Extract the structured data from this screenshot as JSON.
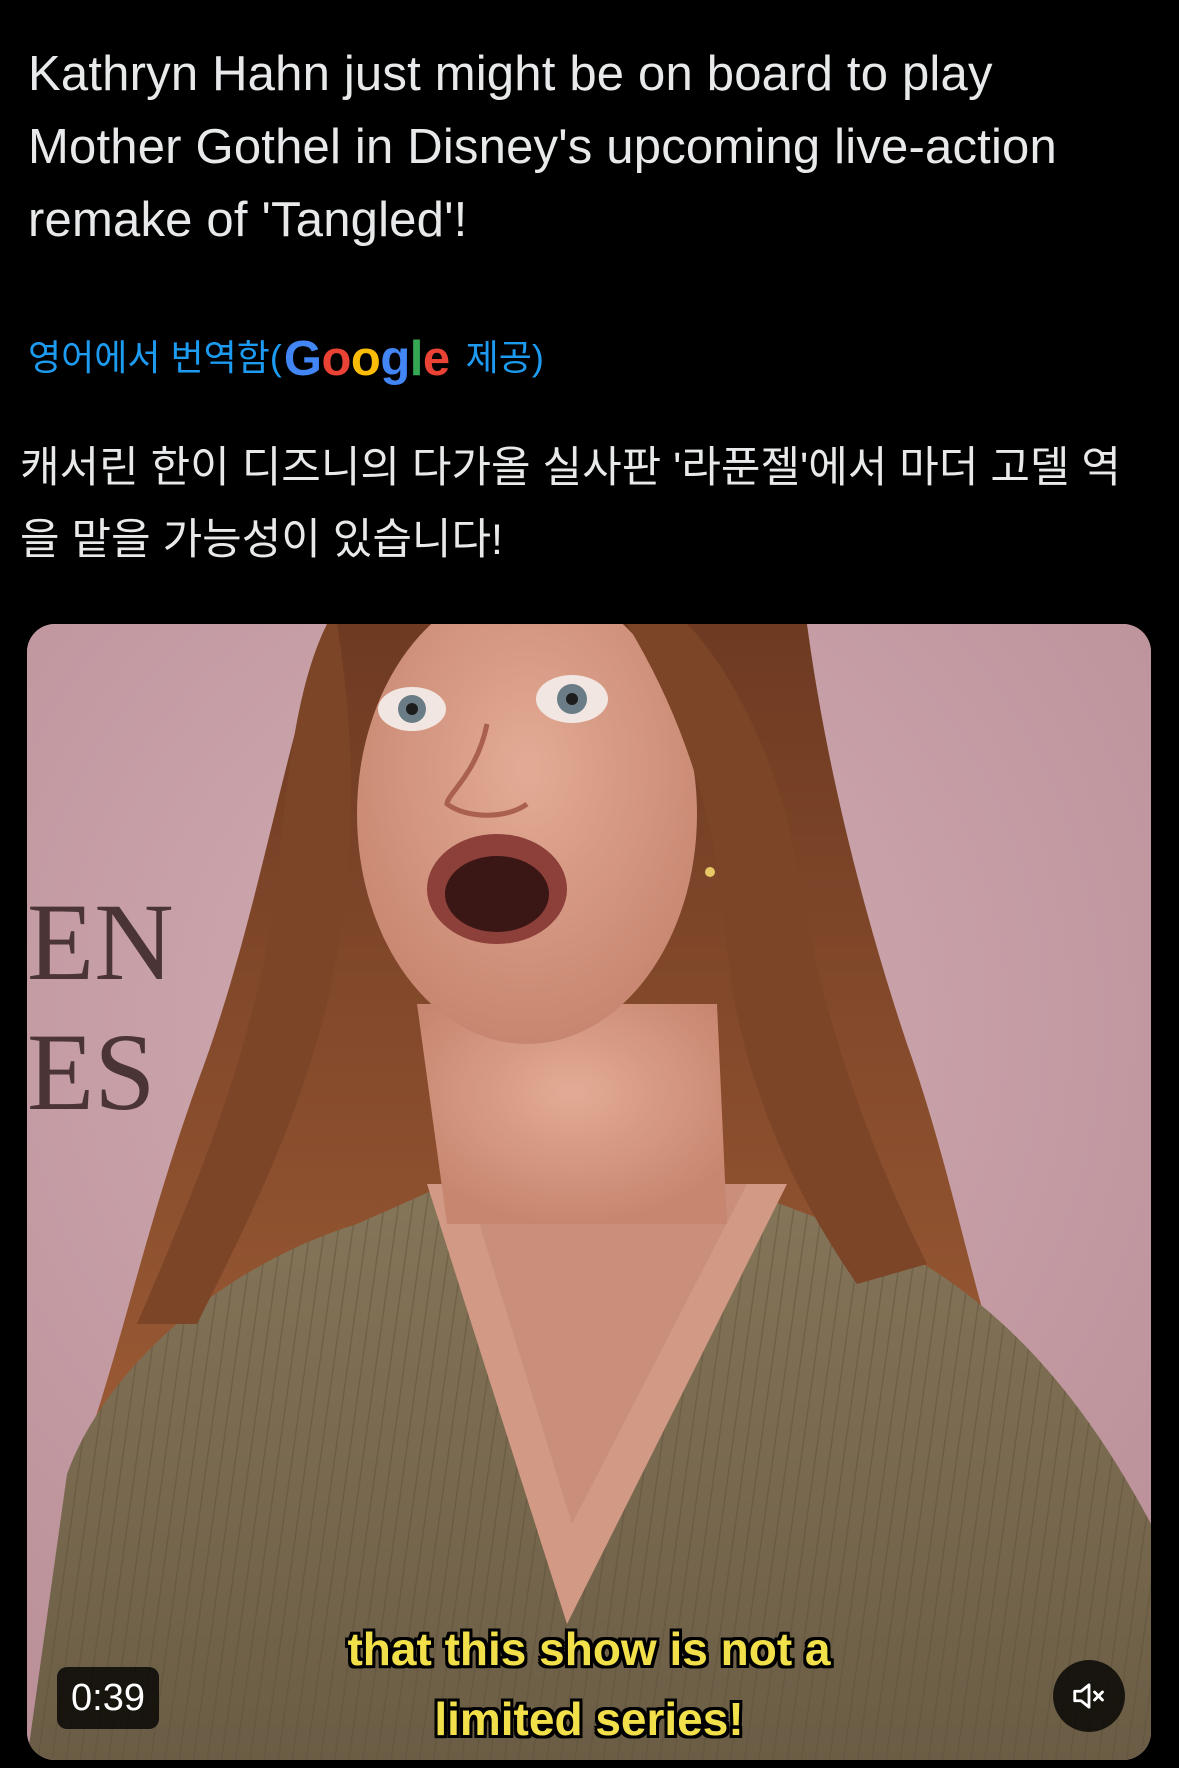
{
  "tweet": {
    "text": "Kathryn Hahn just might be on board to play Mother Gothel in Disney's upcoming live-action remake of 'Tangled'!"
  },
  "translation": {
    "translated_from": "영어에서 번역함(",
    "provider": "Google",
    "provided_by": "제공)",
    "text": "캐서린 한이 디즈니의 다가올 실사판 '라푼젤'에서 마더 고델 역을 맡을 가능성이 있습니다!"
  },
  "video": {
    "caption_line1": "that this show is not a",
    "caption_line2": "limited series!",
    "time_remaining": "0:39",
    "backdrop_letters_1": "EN",
    "backdrop_letters_2": "ES",
    "mute_icon": "speaker-muted-icon"
  },
  "colors": {
    "background": "#000000",
    "text": "#e7e9ea",
    "link": "#1d9bf0",
    "caption": "#f2e04a",
    "google_blue": "#4285f4",
    "google_red": "#ea4335",
    "google_yellow": "#fbbc05",
    "google_green": "#34a853"
  }
}
